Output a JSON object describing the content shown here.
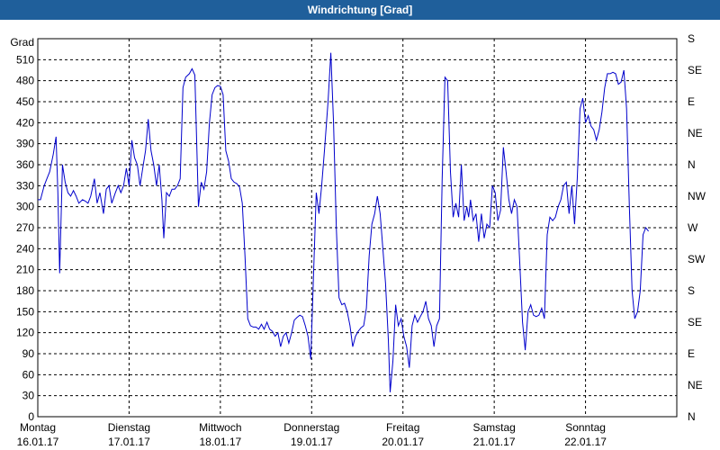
{
  "window": {
    "title": "Windrichtung [Grad]"
  },
  "chart_data": {
    "type": "line",
    "title": "Windrichtung [Grad]",
    "ylabel": "Grad",
    "ylim": [
      0,
      540
    ],
    "y_ticks": [
      0,
      30,
      60,
      90,
      120,
      150,
      180,
      210,
      240,
      270,
      300,
      330,
      360,
      390,
      420,
      450,
      480,
      510
    ],
    "right_ticks": [
      {
        "value": 0,
        "label": "N"
      },
      {
        "value": 45,
        "label": "NE"
      },
      {
        "value": 90,
        "label": "E"
      },
      {
        "value": 135,
        "label": "SE"
      },
      {
        "value": 180,
        "label": "S"
      },
      {
        "value": 225,
        "label": "SW"
      },
      {
        "value": 270,
        "label": "W"
      },
      {
        "value": 315,
        "label": "NW"
      },
      {
        "value": 360,
        "label": "N"
      },
      {
        "value": 405,
        "label": "NE"
      },
      {
        "value": 450,
        "label": "E"
      },
      {
        "value": 495,
        "label": "SE"
      },
      {
        "value": 540,
        "label": "S"
      }
    ],
    "xlim": [
      0,
      7
    ],
    "x_labels": [
      {
        "day": "Montag",
        "date": "16.01.17",
        "x": 0
      },
      {
        "day": "Dienstag",
        "date": "17.01.17",
        "x": 1
      },
      {
        "day": "Mittwoch",
        "date": "18.01.17",
        "x": 2
      },
      {
        "day": "Donnerstag",
        "date": "19.01.17",
        "x": 3
      },
      {
        "day": "Freitag",
        "date": "20.01.17",
        "x": 4
      },
      {
        "day": "Samstag",
        "date": "21.01.17",
        "x": 5
      },
      {
        "day": "Sonntag",
        "date": "22.01.17",
        "x": 6
      }
    ],
    "grid": true,
    "color": "#0000cc",
    "series": [
      {
        "points": [
          [
            0.0,
            310
          ],
          [
            0.03,
            310
          ],
          [
            0.07,
            330
          ],
          [
            0.1,
            340
          ],
          [
            0.13,
            350
          ],
          [
            0.17,
            375
          ],
          [
            0.2,
            400
          ],
          [
            0.22,
            320
          ],
          [
            0.24,
            205
          ],
          [
            0.27,
            360
          ],
          [
            0.3,
            335
          ],
          [
            0.33,
            320
          ],
          [
            0.36,
            315
          ],
          [
            0.39,
            323
          ],
          [
            0.42,
            315
          ],
          [
            0.45,
            305
          ],
          [
            0.49,
            310
          ],
          [
            0.52,
            308
          ],
          [
            0.55,
            305
          ],
          [
            0.58,
            315
          ],
          [
            0.62,
            340
          ],
          [
            0.65,
            305
          ],
          [
            0.68,
            320
          ],
          [
            0.72,
            290
          ],
          [
            0.75,
            325
          ],
          [
            0.78,
            330
          ],
          [
            0.81,
            305
          ],
          [
            0.85,
            320
          ],
          [
            0.88,
            330
          ],
          [
            0.91,
            320
          ],
          [
            0.94,
            330
          ],
          [
            0.97,
            355
          ],
          [
            1.0,
            330
          ],
          [
            1.03,
            395
          ],
          [
            1.06,
            370
          ],
          [
            1.09,
            360
          ],
          [
            1.12,
            330
          ],
          [
            1.15,
            355
          ],
          [
            1.18,
            380
          ],
          [
            1.21,
            425
          ],
          [
            1.24,
            380
          ],
          [
            1.27,
            360
          ],
          [
            1.3,
            330
          ],
          [
            1.33,
            360
          ],
          [
            1.36,
            310
          ],
          [
            1.38,
            255
          ],
          [
            1.41,
            320
          ],
          [
            1.44,
            315
          ],
          [
            1.47,
            325
          ],
          [
            1.5,
            325
          ],
          [
            1.53,
            330
          ],
          [
            1.56,
            340
          ],
          [
            1.59,
            470
          ],
          [
            1.62,
            485
          ],
          [
            1.66,
            490
          ],
          [
            1.69,
            497
          ],
          [
            1.72,
            488
          ],
          [
            1.76,
            300
          ],
          [
            1.79,
            335
          ],
          [
            1.82,
            325
          ],
          [
            1.85,
            350
          ],
          [
            1.88,
            420
          ],
          [
            1.91,
            460
          ],
          [
            1.94,
            470
          ],
          [
            1.97,
            473
          ],
          [
            2.0,
            472
          ],
          [
            2.03,
            460
          ],
          [
            2.06,
            380
          ],
          [
            2.09,
            365
          ],
          [
            2.12,
            340
          ],
          [
            2.15,
            335
          ],
          [
            2.18,
            333
          ],
          [
            2.21,
            328
          ],
          [
            2.24,
            305
          ],
          [
            2.27,
            230
          ],
          [
            2.3,
            140
          ],
          [
            2.33,
            130
          ],
          [
            2.36,
            128
          ],
          [
            2.39,
            128
          ],
          [
            2.42,
            125
          ],
          [
            2.45,
            132
          ],
          [
            2.48,
            125
          ],
          [
            2.51,
            135
          ],
          [
            2.54,
            125
          ],
          [
            2.57,
            122
          ],
          [
            2.6,
            115
          ],
          [
            2.63,
            120
          ],
          [
            2.66,
            100
          ],
          [
            2.69,
            115
          ],
          [
            2.72,
            120
          ],
          [
            2.75,
            105
          ],
          [
            2.78,
            120
          ],
          [
            2.81,
            138
          ],
          [
            2.84,
            142
          ],
          [
            2.87,
            145
          ],
          [
            2.9,
            143
          ],
          [
            2.93,
            130
          ],
          [
            2.96,
            115
          ],
          [
            2.99,
            82
          ],
          [
            3.02,
            200
          ],
          [
            3.05,
            320
          ],
          [
            3.08,
            290
          ],
          [
            3.11,
            330
          ],
          [
            3.14,
            380
          ],
          [
            3.18,
            450
          ],
          [
            3.21,
            520
          ],
          [
            3.24,
            420
          ],
          [
            3.27,
            270
          ],
          [
            3.3,
            170
          ],
          [
            3.33,
            160
          ],
          [
            3.36,
            162
          ],
          [
            3.39,
            150
          ],
          [
            3.42,
            130
          ],
          [
            3.45,
            100
          ],
          [
            3.48,
            115
          ],
          [
            3.51,
            122
          ],
          [
            3.54,
            127
          ],
          [
            3.57,
            130
          ],
          [
            3.6,
            155
          ],
          [
            3.63,
            230
          ],
          [
            3.66,
            275
          ],
          [
            3.69,
            290
          ],
          [
            3.72,
            315
          ],
          [
            3.75,
            290
          ],
          [
            3.78,
            240
          ],
          [
            3.81,
            190
          ],
          [
            3.84,
            110
          ],
          [
            3.86,
            35
          ],
          [
            3.89,
            80
          ],
          [
            3.92,
            160
          ],
          [
            3.95,
            130
          ],
          [
            3.98,
            140
          ],
          [
            4.01,
            115
          ],
          [
            4.04,
            100
          ],
          [
            4.07,
            70
          ],
          [
            4.1,
            130
          ],
          [
            4.13,
            145
          ],
          [
            4.16,
            135
          ],
          [
            4.19,
            143
          ],
          [
            4.22,
            150
          ],
          [
            4.25,
            165
          ],
          [
            4.28,
            140
          ],
          [
            4.31,
            130
          ],
          [
            4.34,
            100
          ],
          [
            4.37,
            130
          ],
          [
            4.4,
            140
          ],
          [
            4.43,
            340
          ],
          [
            4.46,
            485
          ],
          [
            4.49,
            480
          ],
          [
            4.52,
            350
          ],
          [
            4.55,
            285
          ],
          [
            4.58,
            305
          ],
          [
            4.61,
            285
          ],
          [
            4.64,
            360
          ],
          [
            4.67,
            280
          ],
          [
            4.7,
            300
          ],
          [
            4.72,
            285
          ],
          [
            4.74,
            310
          ],
          [
            4.77,
            280
          ],
          [
            4.8,
            290
          ],
          [
            4.83,
            250
          ],
          [
            4.86,
            290
          ],
          [
            4.89,
            255
          ],
          [
            4.92,
            275
          ],
          [
            4.95,
            270
          ],
          [
            4.98,
            330
          ],
          [
            5.01,
            320
          ],
          [
            5.04,
            280
          ],
          [
            5.07,
            295
          ],
          [
            5.1,
            385
          ],
          [
            5.13,
            350
          ],
          [
            5.16,
            310
          ],
          [
            5.19,
            290
          ],
          [
            5.22,
            310
          ],
          [
            5.25,
            300
          ],
          [
            5.28,
            220
          ],
          [
            5.31,
            135
          ],
          [
            5.34,
            95
          ],
          [
            5.37,
            150
          ],
          [
            5.4,
            160
          ],
          [
            5.43,
            145
          ],
          [
            5.46,
            143
          ],
          [
            5.49,
            145
          ],
          [
            5.52,
            155
          ],
          [
            5.55,
            140
          ],
          [
            5.58,
            260
          ],
          [
            5.61,
            285
          ],
          [
            5.64,
            280
          ],
          [
            5.67,
            285
          ],
          [
            5.7,
            300
          ],
          [
            5.73,
            310
          ],
          [
            5.76,
            330
          ],
          [
            5.79,
            335
          ],
          [
            5.82,
            290
          ],
          [
            5.85,
            330
          ],
          [
            5.88,
            275
          ],
          [
            5.91,
            340
          ],
          [
            5.94,
            440
          ],
          [
            5.97,
            455
          ],
          [
            6.0,
            420
          ],
          [
            6.03,
            430
          ],
          [
            6.06,
            415
          ],
          [
            6.09,
            410
          ],
          [
            6.12,
            395
          ],
          [
            6.15,
            410
          ],
          [
            6.18,
            435
          ],
          [
            6.21,
            470
          ],
          [
            6.24,
            490
          ],
          [
            6.27,
            490
          ],
          [
            6.3,
            492
          ],
          [
            6.33,
            490
          ],
          [
            6.36,
            475
          ],
          [
            6.39,
            478
          ],
          [
            6.42,
            495
          ],
          [
            6.45,
            440
          ],
          [
            6.48,
            300
          ],
          [
            6.51,
            180
          ],
          [
            6.54,
            140
          ],
          [
            6.57,
            150
          ],
          [
            6.6,
            180
          ],
          [
            6.63,
            260
          ],
          [
            6.66,
            270
          ],
          [
            6.69,
            265
          ]
        ]
      }
    ]
  }
}
